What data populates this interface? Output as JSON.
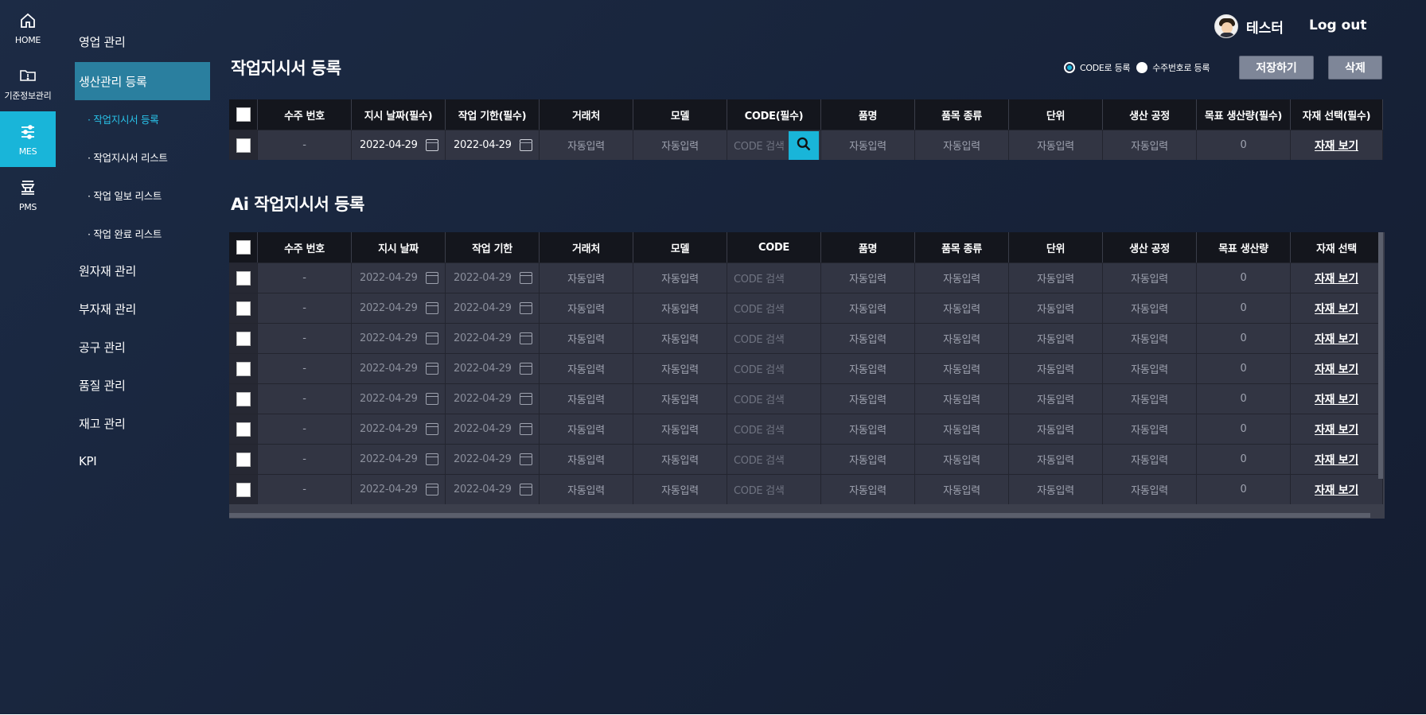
{
  "rail": [
    {
      "label": "HOME",
      "icon": "home-icon"
    },
    {
      "label": "기준정보관리",
      "icon": "folder-alert-icon"
    },
    {
      "label": "MES",
      "icon": "sliders-icon",
      "active": true
    },
    {
      "label": "PMS",
      "icon": "press-machine-icon"
    }
  ],
  "menu": {
    "sales": "영업 관리",
    "production": "생산관리 등록",
    "sub": [
      "· 작업지시서 등록",
      "· 작업지시서 리스트",
      "· 작업 일보 리스트",
      "· 작업 완료 리스트"
    ],
    "raw": "원자재 관리",
    "sub_material": "부자재 관리",
    "tools": "공구 관리",
    "quality": "품질 관리",
    "stock": "재고 관리",
    "kpi": "KPI"
  },
  "header": {
    "user_name": "테스터",
    "logout": "Log out"
  },
  "section1": {
    "title": "작업지시서 등록",
    "radio_code": "CODE로 등록",
    "radio_order": "수주번호로 등록",
    "save": "저장하기",
    "delete": "삭제",
    "columns": [
      "수주 번호",
      "지시 날짜(필수)",
      "작업 기한(필수)",
      "거래처",
      "모델",
      "CODE(필수)",
      "품명",
      "품목 종류",
      "단위",
      "생산 공정",
      "목표 생산량(필수)",
      "자재 선택(필수)"
    ],
    "row": {
      "order_no": "-",
      "date": "2022-04-29",
      "deadline": "2022-04-29",
      "auto": "자동입력",
      "code": "CODE 검색",
      "target": "0",
      "material": "자재 보기"
    }
  },
  "section2": {
    "title": "Ai 작업지시서 등록",
    "columns": [
      "수주 번호",
      "지시 날짜",
      "작업 기한",
      "거래처",
      "모델",
      "CODE",
      "품명",
      "품목 종류",
      "단위",
      "생산 공정",
      "목표 생산량",
      "자재 선택"
    ],
    "row": {
      "order_no": "-",
      "date": "2022-04-29",
      "deadline": "2022-04-29",
      "auto": "자동입력",
      "code": "CODE 검색",
      "target": "0",
      "material": "자재 보기"
    }
  }
}
